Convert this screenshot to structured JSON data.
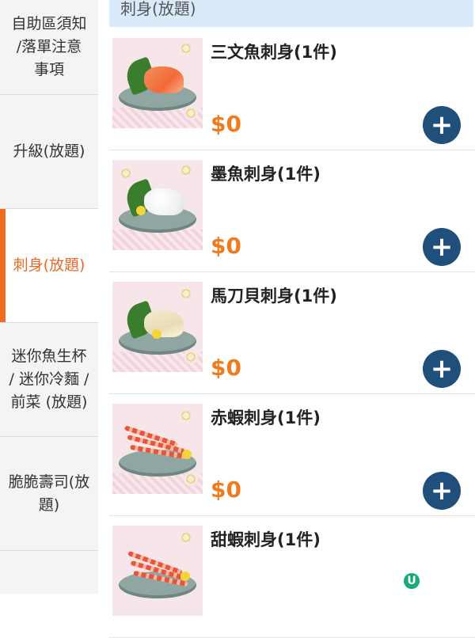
{
  "sidebar": {
    "items": [
      {
        "lines": [
          "自助區須知",
          "/落單注意",
          "事項"
        ]
      },
      {
        "lines": [
          "升級(放題)"
        ]
      },
      {
        "lines": [
          "刺身(放題)"
        ],
        "active": true
      },
      {
        "lines": [
          "迷你魚生杯",
          "/ 迷你冷麵 /",
          "前菜 (放題)"
        ]
      },
      {
        "lines": [
          "脆脆壽司(放",
          "題)"
        ]
      }
    ]
  },
  "section": {
    "title": "刺身(放題)"
  },
  "products": [
    {
      "name": "三文魚刺身(1件)",
      "price": "$0",
      "add_label": "+",
      "image": "salmon-sashimi"
    },
    {
      "name": "墨魚刺身(1件)",
      "price": "$0",
      "add_label": "+",
      "image": "cuttlefish-sashimi"
    },
    {
      "name": "馬刀貝刺身(1件)",
      "price": "$0",
      "add_label": "+",
      "image": "razor-clam-sashimi"
    },
    {
      "name": "赤蝦刺身(1件)",
      "price": "$0",
      "add_label": "+",
      "image": "red-shrimp-sashimi"
    },
    {
      "name": "甜蝦刺身(1件)",
      "price": "",
      "add_label": "",
      "image": "sweet-shrimp-sashimi"
    }
  ],
  "floating": {
    "u_label": "U"
  },
  "colors": {
    "accent": "#f06a1f",
    "price": "#f07b1e",
    "button": "#1f4f7a",
    "header_bg": "#dbeafb"
  }
}
